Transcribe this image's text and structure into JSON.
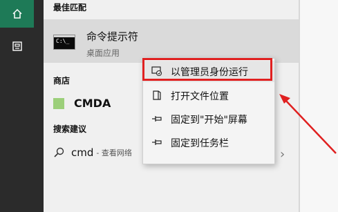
{
  "rail": {
    "items": [
      {
        "icon": "home-icon"
      },
      {
        "icon": "documents-icon"
      }
    ]
  },
  "search_panel": {
    "best_match_title": "最佳匹配",
    "best_match": {
      "name": "命令提示符",
      "type": "桌面应用",
      "icon": "command-prompt-icon"
    },
    "store_title": "商店",
    "store_item": {
      "name": "CMDA",
      "icon": "store-app-icon"
    },
    "suggestions_title": "搜索建议",
    "suggestion": {
      "query": "cmd",
      "sub": "- 查看网络",
      "icon": "search-icon"
    }
  },
  "context_menu": {
    "items": [
      {
        "label": "以管理员身份运行",
        "icon": "run-as-admin-icon",
        "highlighted": true
      },
      {
        "label": "打开文件位置",
        "icon": "open-file-location-icon"
      },
      {
        "label": "固定到\"开始\"屏幕",
        "icon": "pin-icon"
      },
      {
        "label": "固定到任务栏",
        "icon": "pin-icon"
      }
    ]
  },
  "colors": {
    "accent_green": "#1e7a57",
    "highlight_box_red": "#e02020",
    "rail_bg": "#2b2b2b"
  }
}
